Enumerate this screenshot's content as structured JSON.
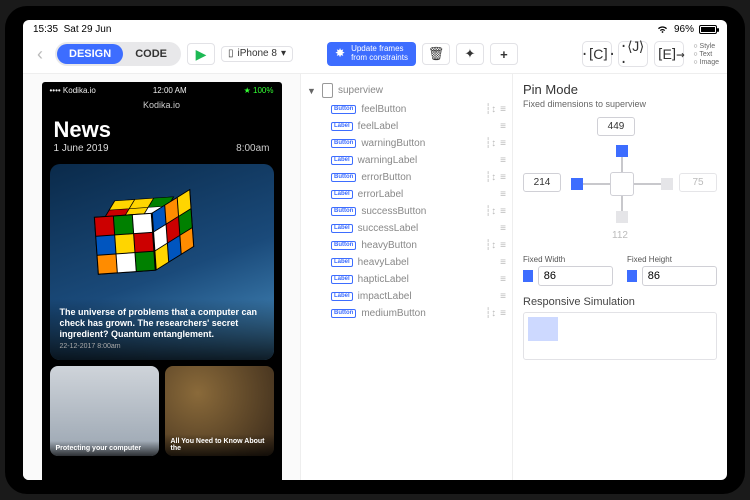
{
  "status": {
    "time": "15:35",
    "date": "Sat 29 Jun",
    "battery": "96%"
  },
  "segmented": {
    "design": "DESIGN",
    "code": "CODE"
  },
  "device": {
    "name": "iPhone 8"
  },
  "update_btn": {
    "line1": "Update frames",
    "line2": "from constraints"
  },
  "align_icons": [
    "C",
    "J",
    "E"
  ],
  "radio_labels": [
    "Style",
    "Text",
    "Image"
  ],
  "phone": {
    "carrier": "•••• Kodika.io",
    "clock": "12:00 AM",
    "battery": "★ 100%",
    "app": "Kodika.io",
    "headline": "News",
    "subdate": "1 June 2019",
    "subtime": "8:00am",
    "hero_text": "The universe of problems that a computer can check has grown. The researchers' secret ingredient? Quantum entanglement.",
    "hero_meta": "22-12-2017  8:00am",
    "card1": "Protecting your computer",
    "card2": "All You Need to Know About the"
  },
  "tree": {
    "root": "superview",
    "items": [
      {
        "type": "Button",
        "name": "feelButton",
        "acts": true
      },
      {
        "type": "Label",
        "name": "feelLabel"
      },
      {
        "type": "Button",
        "name": "warningButton",
        "acts": true
      },
      {
        "type": "Label",
        "name": "warningLabel"
      },
      {
        "type": "Button",
        "name": "errorButton",
        "acts": true
      },
      {
        "type": "Label",
        "name": "errorLabel"
      },
      {
        "type": "Button",
        "name": "successButton",
        "acts": true
      },
      {
        "type": "Label",
        "name": "successLabel"
      },
      {
        "type": "Button",
        "name": "heavyButton",
        "acts": true
      },
      {
        "type": "Label",
        "name": "heavyLabel"
      },
      {
        "type": "Label",
        "name": "hapticLabel"
      },
      {
        "type": "Label",
        "name": "impactLabel"
      },
      {
        "type": "Button",
        "name": "mediumButton",
        "acts": true
      }
    ]
  },
  "inspector": {
    "title": "Pin Mode",
    "subtitle": "Fixed dimensions to superview",
    "pins": {
      "top": "449",
      "left": "214",
      "right": "75",
      "bottom": "112"
    },
    "fixed_width_label": "Fixed Width",
    "fixed_height_label": "Fixed Height",
    "fixed_width": "86",
    "fixed_height": "86",
    "responsive": "Responsive Simulation"
  }
}
